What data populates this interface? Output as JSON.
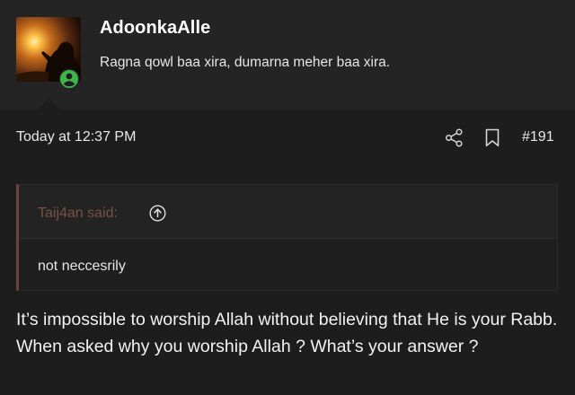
{
  "user": {
    "name": "AdoonkaAlle",
    "title": "Ragna qowl baa xira, dumarna meher baa xira."
  },
  "post": {
    "timestamp": "Today at 12:37 PM",
    "number": "#191",
    "quote": {
      "author": "Taij4an said:",
      "text": "not neccesrily"
    },
    "body": "It’s impossible to worship Allah without believing that He is your Rabb. When asked why you worship Allah ? What’s your answer ?"
  },
  "icons": {
    "avatar": "avatar-image",
    "online": "online-status-icon",
    "share": "share-icon",
    "bookmark": "bookmark-icon",
    "quote_jump": "arrow-up-circle-icon"
  },
  "colors": {
    "background": "#1d1d1d",
    "header_background": "#242424",
    "quote_accent": "#6e4238",
    "quote_author": "#7a5147",
    "online_green": "#3fb649"
  }
}
